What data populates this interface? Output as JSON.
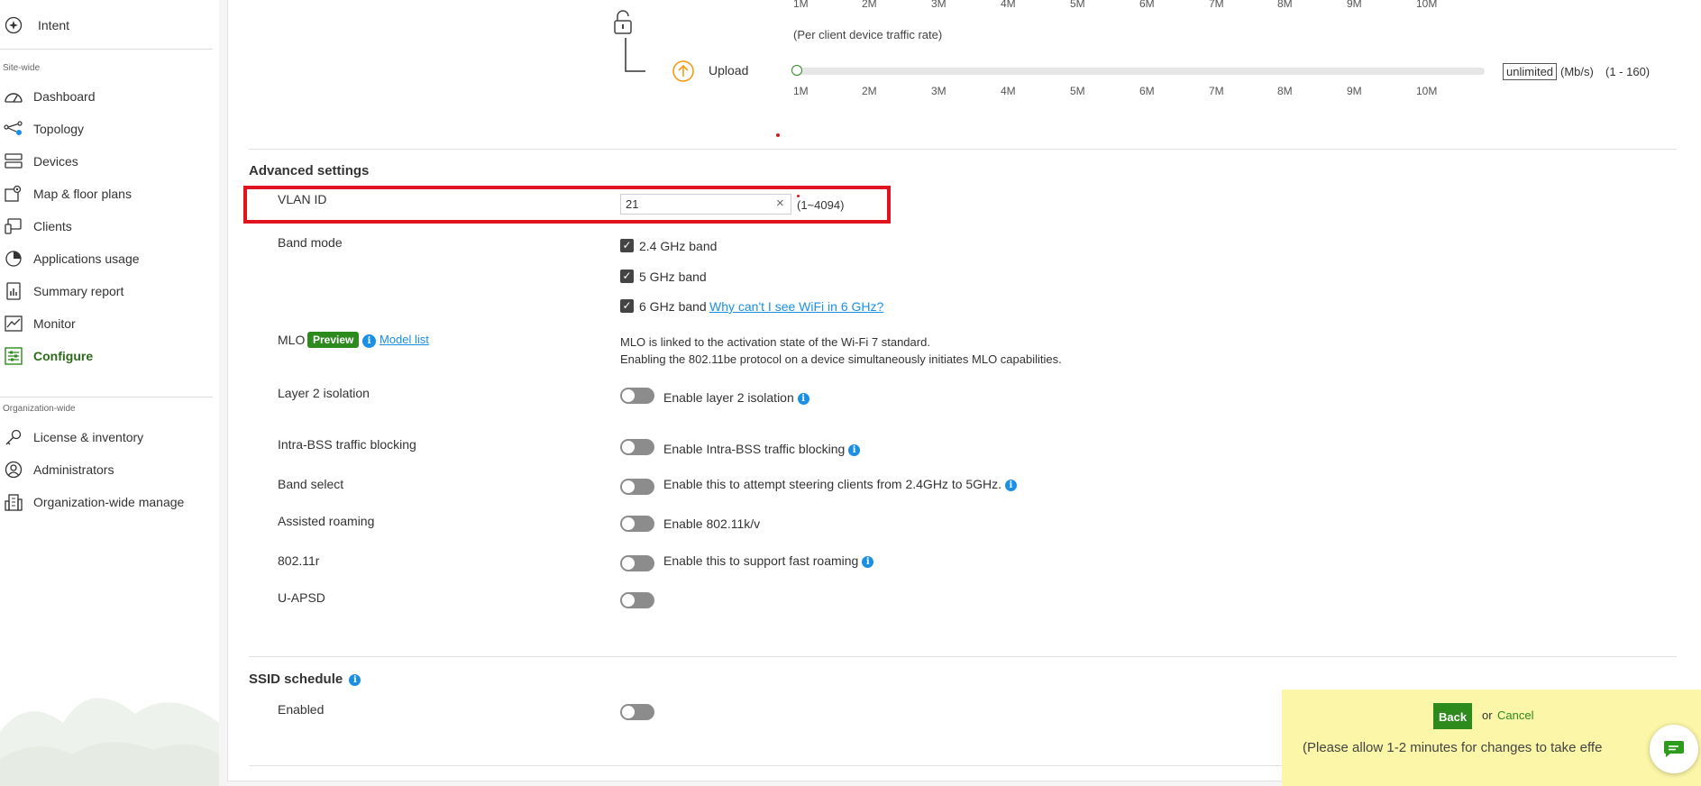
{
  "sidebar": {
    "intent_label": "Intent",
    "site_wide_label": "Site-wide",
    "site_items": [
      {
        "label": "Dashboard",
        "icon": "dashboard-icon"
      },
      {
        "label": "Topology",
        "icon": "topology-icon"
      },
      {
        "label": "Devices",
        "icon": "devices-icon"
      },
      {
        "label": "Map & floor plans",
        "icon": "map-icon"
      },
      {
        "label": "Clients",
        "icon": "clients-icon"
      },
      {
        "label": "Applications usage",
        "icon": "pie-chart-icon"
      },
      {
        "label": "Summary report",
        "icon": "report-icon"
      },
      {
        "label": "Monitor",
        "icon": "monitor-icon"
      },
      {
        "label": "Configure",
        "icon": "configure-icon"
      }
    ],
    "org_wide_label": "Organization-wide",
    "org_items": [
      {
        "label": "License & inventory",
        "icon": "key-icon"
      },
      {
        "label": "Administrators",
        "icon": "admin-icon"
      },
      {
        "label": "Organization-wide manage",
        "icon": "building-icon"
      }
    ]
  },
  "traffic": {
    "per_client_note": "(Per client device traffic rate)",
    "upload_label": "Upload",
    "ticks": [
      "1M",
      "2M",
      "3M",
      "4M",
      "5M",
      "6M",
      "7M",
      "8M",
      "9M",
      "10M"
    ],
    "upload_value": "unlimited",
    "unit": "(Mb/s)",
    "range": "(1 - 160)"
  },
  "advanced": {
    "heading": "Advanced settings",
    "vlan_label": "VLAN ID",
    "vlan_value": "21",
    "vlan_range": "(1~4094)",
    "band_mode_label": "Band mode",
    "band_24": "2.4 GHz band",
    "band_5": "5 GHz band",
    "band_6": "6 GHz band",
    "wifi6_link": "Why can't I see WiFi in 6 GHz?",
    "mlo_label": "MLO",
    "mlo_badge": "Preview",
    "model_list_link": "Model list",
    "mlo_line1": "MLO is linked to the activation state of the Wi-Fi 7 standard.",
    "mlo_line2": "Enabling the 802.11be protocol on a device simultaneously initiates MLO capabilities.",
    "l2_label": "Layer 2 isolation",
    "l2_text": "Enable layer 2 isolation",
    "intra_label": "Intra-BSS traffic blocking",
    "intra_text": "Enable Intra-BSS traffic blocking",
    "band_select_label": "Band select",
    "band_select_text": "Enable this to attempt steering clients from 2.4GHz to 5GHz.",
    "roaming_label": "Assisted roaming",
    "roaming_text": "Enable 802.11k/v",
    "r_label": "802.11r",
    "r_text": "Enable this to support fast roaming",
    "uapsd_label": "U-APSD"
  },
  "schedule": {
    "heading": "SSID schedule",
    "enabled_label": "Enabled"
  },
  "footer": {
    "back_label": "Back",
    "or_text": "or",
    "cancel_label": "Cancel",
    "note": "(Please allow 1-2 minutes for changes to take effe"
  },
  "colors": {
    "accent_green": "#2d8a1c",
    "link_blue": "#1a8fe6",
    "highlight_red": "#e0141e",
    "upload_orange": "#f39c12"
  }
}
